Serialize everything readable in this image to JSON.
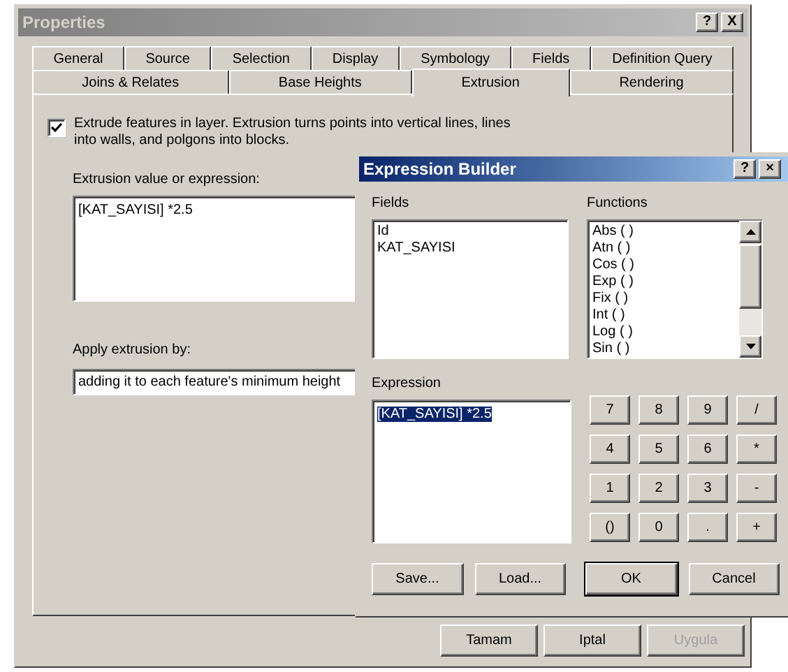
{
  "properties": {
    "title": "Properties",
    "title_buttons": [
      "?",
      "X"
    ],
    "tab_rows": [
      [
        {
          "label": "General",
          "selected": false
        },
        {
          "label": "Source",
          "selected": false
        },
        {
          "label": "Selection",
          "selected": false
        },
        {
          "label": "Display",
          "selected": false
        },
        {
          "label": "Symbology",
          "selected": false
        },
        {
          "label": "Fields",
          "selected": false
        },
        {
          "label": "Definition Query",
          "selected": false
        }
      ],
      [
        {
          "label": "Joins & Relates",
          "selected": false
        },
        {
          "label": "Base Heights",
          "selected": false
        },
        {
          "label": "Extrusion",
          "selected": true
        },
        {
          "label": "Rendering",
          "selected": false
        }
      ]
    ],
    "extrude": {
      "label": "Extrude features in layer.  Extrusion turns points into vertical lines, lines into walls, and polgons into blocks.",
      "checked": true
    },
    "value_label": "Extrusion value or expression:",
    "value": "[KAT_SAYISI] *2.5",
    "apply_label": "Apply extrusion by:",
    "apply_value": "adding it to each feature's minimum height",
    "buttons": [
      {
        "label": "Tamam",
        "disabled": false
      },
      {
        "label": "Iptal",
        "disabled": false
      },
      {
        "label": "Uygula",
        "disabled": true
      }
    ]
  },
  "expression_builder": {
    "title": "Expression Builder",
    "title_buttons": [
      "?",
      "×"
    ],
    "fields_label": "Fields",
    "fields": [
      "Id",
      "KAT_SAYISI"
    ],
    "functions_label": "Functions",
    "functions": [
      "Abs ( )",
      "Atn ( )",
      "Cos ( )",
      "Exp ( )",
      "Fix ( )",
      "Int ( )",
      "Log ( )",
      "Sin ( )"
    ],
    "expression_label": "Expression",
    "expression": {
      "text": "[KAT_SAYISI] *2.5",
      "selected": true
    },
    "keypad": [
      "7",
      "8",
      "9",
      "/",
      "4",
      "5",
      "6",
      "*",
      "1",
      "2",
      "3",
      "-",
      "()",
      "0",
      ".",
      "+"
    ],
    "buttons": [
      {
        "label": "Save...",
        "default": false
      },
      {
        "label": "Load...",
        "default": false
      },
      {
        "label": "OK",
        "default": true
      },
      {
        "label": "Cancel",
        "default": false
      }
    ]
  }
}
